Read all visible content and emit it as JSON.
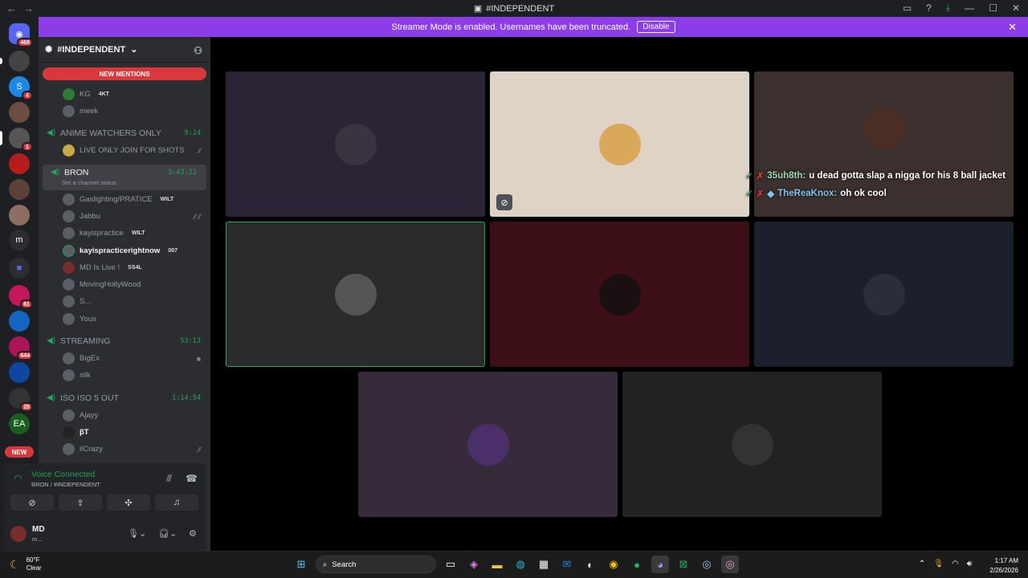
{
  "titlebar": {
    "title": "#INDEPENDENT"
  },
  "banner": {
    "text": "Streamer Mode is enabled. Usernames have been truncated.",
    "disable": "Disable"
  },
  "servers": {
    "top_badge": "468",
    "s2_badge": "4",
    "s3_badge": "1",
    "badge_61": "61",
    "badge_644": "644",
    "badge_25": "25",
    "m_label": "m",
    "new_label": "NEW"
  },
  "channel": {
    "name": "#INDEPENDENT",
    "new_mentions": "NEW MENTIONS"
  },
  "sidebar": {
    "u_kg": "KG",
    "u_kg_tag": "4KT",
    "u_meek": "meek",
    "vc_anime": "ANIME WATCHERS ONLY",
    "vc_anime_time": "9:24",
    "u_live": "LIVE ONLY JOIN FOR SHOTS",
    "vc_bron": "BRON",
    "vc_bron_time": "3:43:22",
    "vc_bron_status": "Set a channel status",
    "u_gas": "Gaslighting/PRATICE",
    "u_gas_tag": "WILT",
    "u_jabbu": "Jabbu",
    "u_kayis": "kayispractice",
    "u_kayis_tag": "WILT",
    "u_kayis2": "kayispracticerightnow",
    "u_kayis2_tag": "007",
    "u_md": "MD Is Live !",
    "u_md_tag": "SS4L",
    "u_moving": "MovingHollyWood",
    "u_s": "S...",
    "u_yous": "Yous",
    "vc_stream": "STREAMING",
    "vc_stream_time": "53:13",
    "u_bigex": "BigEx",
    "u_silk": "silk",
    "vc_iso": "ISO ISO 5 OUT",
    "vc_iso_time": "1:14:54",
    "u_ajayy": "Ajayy",
    "u_bt": "βT",
    "u_ilcrazy": "ilCrazy"
  },
  "voice": {
    "status": "Voice Connected",
    "location": "BRON / #INDEPENDENT"
  },
  "me": {
    "name": "MD",
    "status": "m..."
  },
  "overlay": {
    "user1": "35uh8th:",
    "msg1": "u dead gotta slap a nigga for his 8 ball jacket",
    "user2": "TheReaKnox:",
    "msg2": "oh ok cool"
  },
  "taskbar": {
    "temp": "60°F",
    "cond": "Clear",
    "search": "Search",
    "time": "1:17 AM",
    "date": "2/26/2026"
  },
  "colors": {
    "accent": "#8c3de8",
    "green": "#23a55a",
    "red": "#da373c"
  }
}
